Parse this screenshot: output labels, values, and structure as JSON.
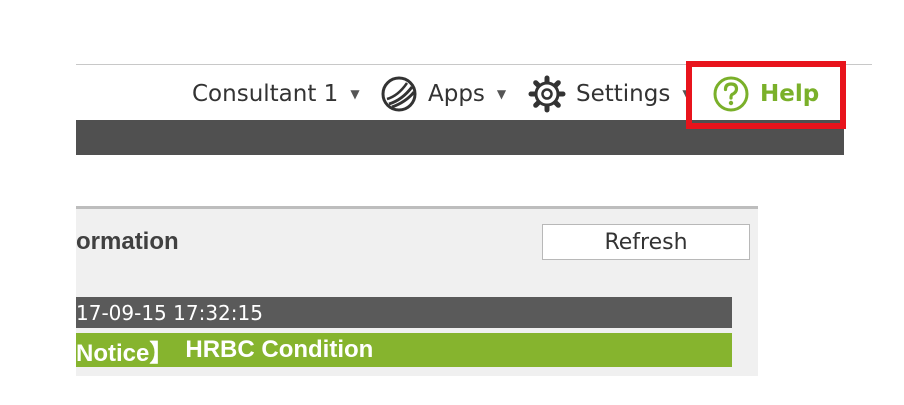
{
  "header": {
    "user": {
      "label": "Consultant 1"
    },
    "apps": {
      "label": "Apps",
      "icon": "globe-icon"
    },
    "settings": {
      "label": "Settings",
      "icon": "gear-icon"
    },
    "help": {
      "label": "Help",
      "icon": "question-circle-icon",
      "color": "#7ab02a",
      "highlight_color": "#e8141c"
    }
  },
  "panel": {
    "title": "ormation",
    "refresh_label": "Refresh",
    "timestamp": "17-09-15 17:32:15",
    "notice": {
      "tag": "Notice】",
      "text": "HRBC Condition",
      "color": "#86b42e"
    }
  },
  "colors": {
    "dark_bar": "#505050",
    "timestamp_bar": "#5a5a5a"
  }
}
